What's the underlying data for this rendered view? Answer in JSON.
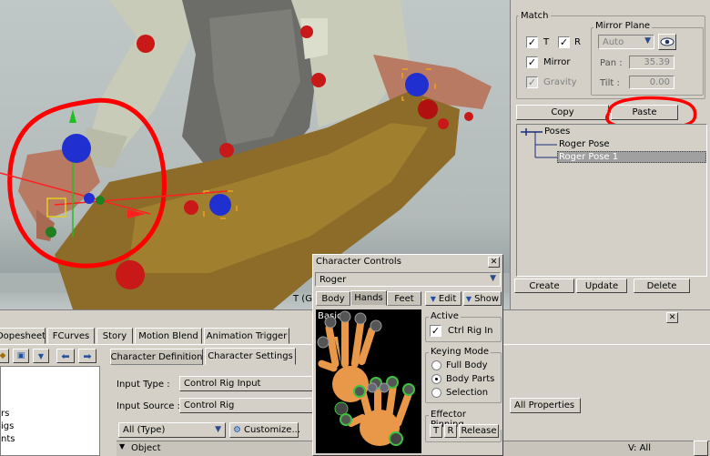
{
  "viewport": {
    "overlay_text": "T (G",
    "colors": {
      "figure_shirt": "#c8cbb8",
      "figure_vest": "#6c6c68",
      "figure_pants": "#8c6c28",
      "effector_red": "#c81818",
      "effector_blue": "#2030d0",
      "annotation": "#ff0000"
    }
  },
  "match": {
    "title": "Match",
    "t_label": "T",
    "r_label": "R",
    "mirror_label": "Mirror",
    "gravity_label": "Gravity"
  },
  "mirror_plane": {
    "title": "Mirror Plane",
    "mode_value": "Auto",
    "pan_label": "Pan :",
    "pan_value": "35.39",
    "tilt_label": "Tilt :",
    "tilt_value": "0.00"
  },
  "pose_buttons": {
    "copy": "Copy",
    "paste": "Paste"
  },
  "poses": {
    "root": "Poses",
    "items": [
      "Roger Pose",
      "Roger Pose 1"
    ]
  },
  "pose_actions": {
    "create": "Create",
    "update": "Update",
    "delete": "Delete"
  },
  "character_controls": {
    "title": "Character Controls",
    "character": "Roger",
    "tabs": [
      "Body",
      "Hands",
      "Feet"
    ],
    "edit_label": "Edit",
    "show_label": "Show",
    "view_label": "Basic",
    "active_title": "Active",
    "ctrl_rig_label": "Ctrl Rig In",
    "keying_title": "Keying Mode",
    "keying_options": [
      "Full Body",
      "Body Parts",
      "Selection"
    ],
    "pinning_title": "Effector Pinning",
    "pin_t": "T",
    "pin_r": "R",
    "release": "Release"
  },
  "bottom_tabs": [
    "Dopesheet",
    "FCurves",
    "Story",
    "Motion Blend",
    "Animation Trigger"
  ],
  "character_tabs": [
    "Character Definition",
    "Character Settings"
  ],
  "settings": {
    "input_type_label": "Input Type :",
    "input_type_value": "Control Rig Input",
    "input_source_label": "Input Source :",
    "input_source_value": "Control Rig",
    "type_filter": "All (Type)",
    "customize": "Customize...",
    "object_header": "Object",
    "all_properties": "All Properties",
    "v_all": "V: All"
  },
  "left_tree": [
    "rs",
    "igs",
    "nts"
  ]
}
